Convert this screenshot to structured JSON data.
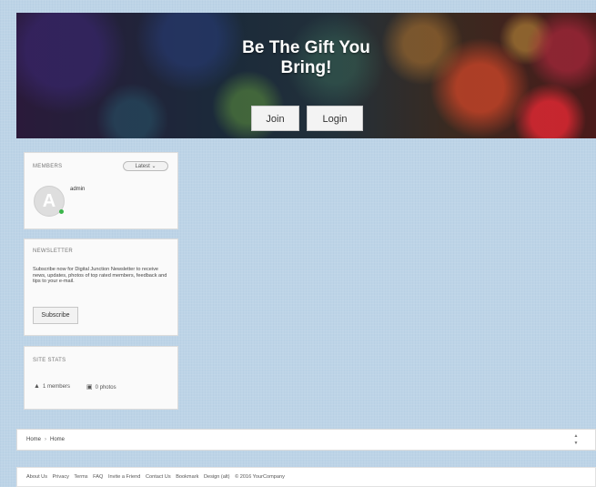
{
  "hero": {
    "title_line1": "Be The Gift You",
    "title_line2": "Bring!",
    "join_label": "Join",
    "login_label": "Login"
  },
  "members_widget": {
    "title": "MEMBERS",
    "filter": "Latest",
    "avatar_letter": "A",
    "member_name": "admin"
  },
  "newsletter_widget": {
    "title": "NEWSLETTER",
    "text": "Subscribe now for Digital Junction Newsletter to receive news, updates, photos of top rated members, feedback and tips to your e-mail.",
    "subscribe_label": "Subscribe"
  },
  "site_stats_widget": {
    "title": "SITE STATS",
    "members": "1 members",
    "photos": "0 photos"
  },
  "breadcrumb": {
    "items": [
      "Home",
      "Home"
    ]
  },
  "footer": {
    "links": [
      "About Us",
      "Privacy",
      "Terms",
      "FAQ",
      "Invite a Friend",
      "Contact Us",
      "Bookmark",
      "Design (alt)",
      "© 2016 YourCompany"
    ]
  },
  "icons": {
    "online_status": "online-dot",
    "members_stat": "user-icon",
    "photos_stat": "photo-icon",
    "dropdown": "chevron-down-icon",
    "scroll": "scroll-arrows-icon"
  },
  "colors": {
    "page_bg": "#bdd4e7",
    "online": "#3ab54a"
  }
}
